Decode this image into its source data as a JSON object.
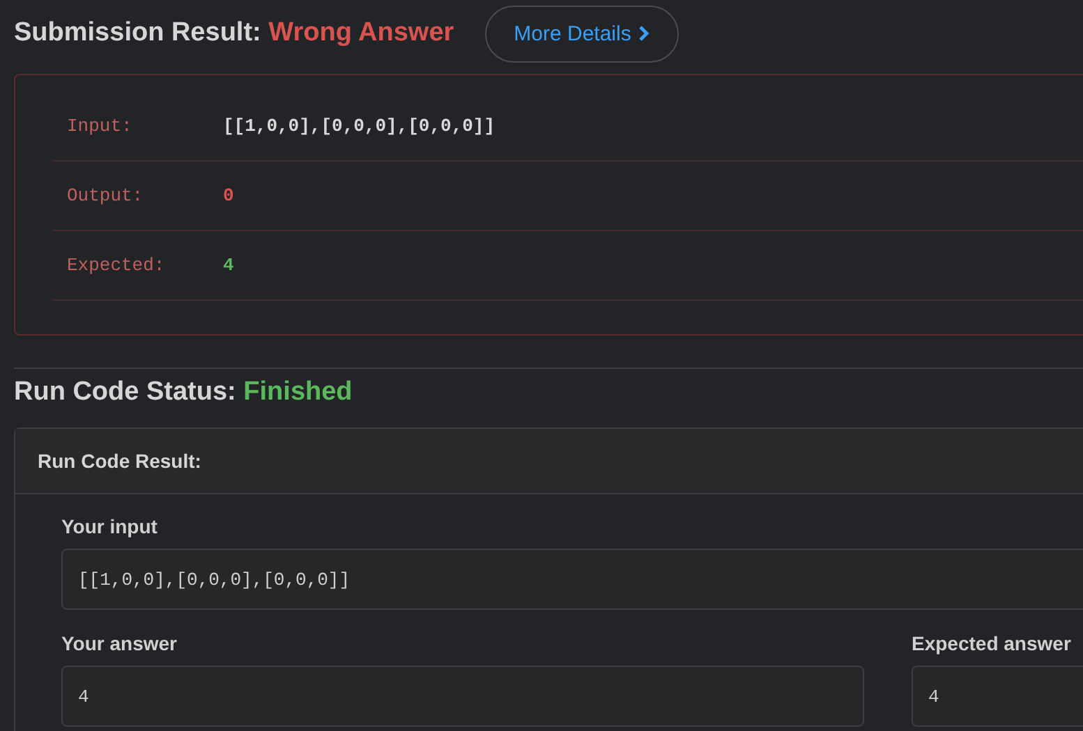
{
  "submission": {
    "label": "Submission Result:",
    "status": "Wrong Answer",
    "kind": "wrong",
    "more_details_button": "More Details"
  },
  "result_rows": [
    {
      "label": "Input:",
      "value": "[[1,0,0],[0,0,0],[0,0,0]]",
      "kind": "neutral"
    },
    {
      "label": "Output:",
      "value": "0",
      "kind": "wrong"
    },
    {
      "label": "Expected:",
      "value": "4",
      "kind": "correct"
    }
  ],
  "run_code": {
    "label": "Run Code Status:",
    "status": "Finished",
    "kind": "correct",
    "card_title": "Run Code Result:",
    "your_input_label": "Your input",
    "your_input": "[[1,0,0],[0,0,0],[0,0,0]]",
    "your_answer_label": "Your answer",
    "your_answer": "4",
    "expected_answer_label": "Expected answer",
    "expected_answer": "4"
  }
}
